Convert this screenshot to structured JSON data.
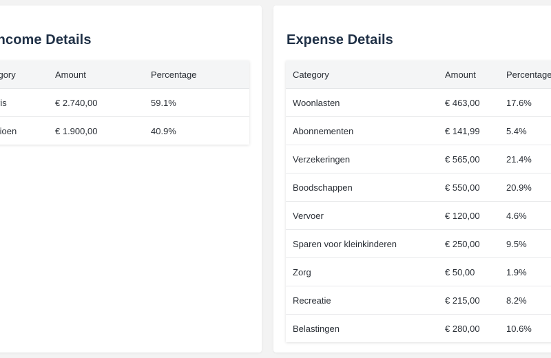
{
  "income": {
    "title": "Income Details",
    "columns": [
      "Category",
      "Amount",
      "Percentage"
    ],
    "rows": [
      {
        "category": "Salaris",
        "amount": "€ 2.740,00",
        "percentage": "59.1%"
      },
      {
        "category": "Pensioen",
        "amount": "€ 1.900,00",
        "percentage": "40.9%"
      }
    ]
  },
  "expense": {
    "title": "Expense Details",
    "columns": [
      "Category",
      "Amount",
      "Percentage"
    ],
    "rows": [
      {
        "category": "Woonlasten",
        "amount": "€ 463,00",
        "percentage": "17.6%"
      },
      {
        "category": "Abonnementen",
        "amount": "€ 141,99",
        "percentage": "5.4%"
      },
      {
        "category": "Verzekeringen",
        "amount": "€ 565,00",
        "percentage": "21.4%"
      },
      {
        "category": "Boodschappen",
        "amount": "€ 550,00",
        "percentage": "20.9%"
      },
      {
        "category": "Vervoer",
        "amount": "€ 120,00",
        "percentage": "4.6%"
      },
      {
        "category": "Sparen voor kleinkinderen",
        "amount": "€ 250,00",
        "percentage": "9.5%"
      },
      {
        "category": "Zorg",
        "amount": "€ 50,00",
        "percentage": "1.9%"
      },
      {
        "category": "Recreatie",
        "amount": "€ 215,00",
        "percentage": "8.2%"
      },
      {
        "category": "Belastingen",
        "amount": "€ 280,00",
        "percentage": "10.6%"
      }
    ]
  }
}
